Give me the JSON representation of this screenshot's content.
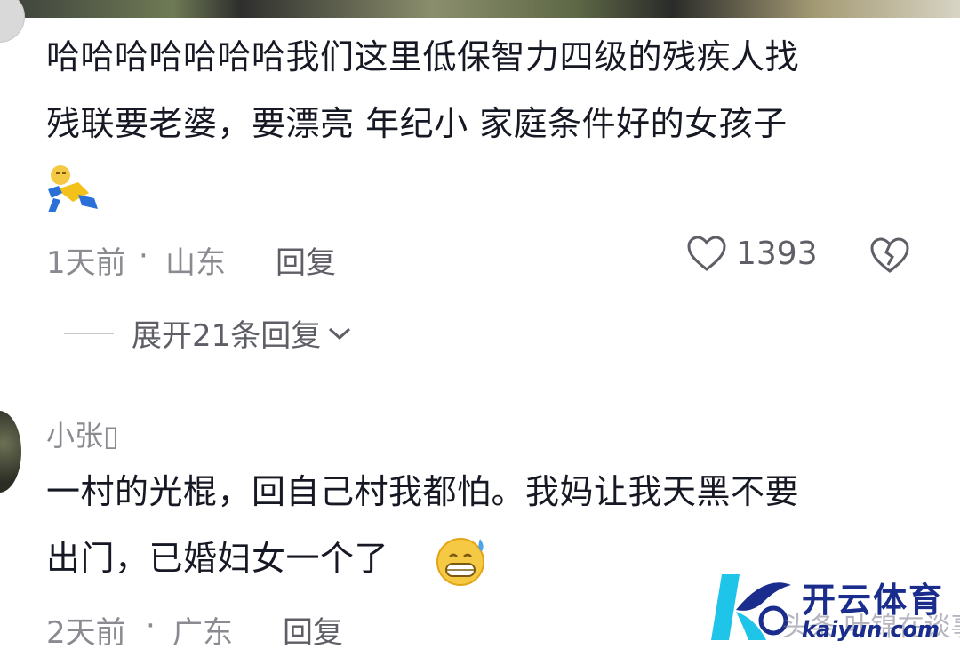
{
  "comments": [
    {
      "text_line1": "哈哈哈哈哈哈哈我们这里低保智力四级的残疾人找",
      "text_line2": "残联要老婆，要漂亮 年纪小 家庭条件好的女孩子",
      "sticker": "falling-person-emoji",
      "time": "1天前",
      "separator": "·",
      "location": "山东",
      "reply_label": "回复",
      "like_count": "1393",
      "expand_label": "展开21条回复"
    },
    {
      "username": "小张▯",
      "text_line1": "一村的光棍，回自己村我都怕。我妈让我天黑不要",
      "text_line2": "出门，已婚妇女一个了",
      "emoji": "grinning-sweat-emoji",
      "time": "2天前",
      "separator": "·",
      "location": "广东",
      "reply_label": "回复"
    }
  ],
  "watermark": {
    "title": "开云体育",
    "url": "kaiyun.com",
    "faded_text": "头条 叶锦在谈事",
    "logo_icon": "k-logo-icon"
  },
  "colors": {
    "text_primary": "#161823",
    "text_secondary": "#8a8b91",
    "watermark_blue": "#1a2c8c",
    "watermark_cyan": "#1ec5e8"
  }
}
